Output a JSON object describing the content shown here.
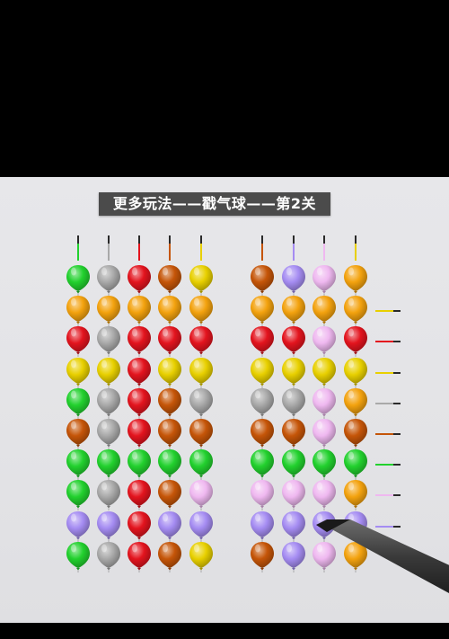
{
  "title": "更多玩法——戳气球——第2关",
  "palette": {
    "G": "#22d12e",
    "S": "#a9a9a9",
    "R": "#e3141e",
    "B": "#c55508",
    "Y": "#e8d000",
    "O": "#f3a20e",
    "P": "#a58cf2",
    "K": "#efb8f0"
  },
  "columns": [
    {
      "needle": "#22d12e",
      "balloons": [
        "G",
        "O",
        "R",
        "Y",
        "G",
        "B",
        "G",
        "G",
        "P",
        "G"
      ]
    },
    {
      "needle": "#a9a9a9",
      "balloons": [
        "S",
        "O",
        "S",
        "Y",
        "S",
        "S",
        "G",
        "S",
        "P",
        "S"
      ]
    },
    {
      "needle": "#e3141e",
      "balloons": [
        "R",
        "O",
        "R",
        "R",
        "R",
        "R",
        "G",
        "R",
        "R",
        "R"
      ]
    },
    {
      "needle": "#c55508",
      "balloons": [
        "B",
        "O",
        "R",
        "Y",
        "B",
        "B",
        "G",
        "B",
        "P",
        "B"
      ]
    },
    {
      "needle": "#e8d000",
      "balloons": [
        "Y",
        "O",
        "R",
        "Y",
        "S",
        "B",
        "G",
        "K",
        "P",
        "Y"
      ]
    },
    {
      "needle": "#c55508",
      "balloons": [
        "B",
        "O",
        "R",
        "Y",
        "S",
        "B",
        "G",
        "K",
        "P",
        "B"
      ]
    },
    {
      "needle": "#a58cf2",
      "balloons": [
        "P",
        "O",
        "R",
        "Y",
        "S",
        "B",
        "G",
        "K",
        "P",
        "P"
      ]
    },
    {
      "needle": "#efb8f0",
      "balloons": [
        "K",
        "O",
        "K",
        "Y",
        "K",
        "K",
        "G",
        "K",
        "P",
        "K"
      ]
    },
    {
      "needle": "#e8d000",
      "balloons": [
        "O",
        "O",
        "R",
        "Y",
        "O",
        "B",
        "G",
        "O",
        "P",
        "O"
      ]
    }
  ],
  "row_darts": [
    "#e8d000",
    "#e3141e",
    "#e8d000",
    "#a9a9a9",
    "#c55508",
    "#22d12e",
    "#efb8f0",
    "#a58cf2"
  ]
}
